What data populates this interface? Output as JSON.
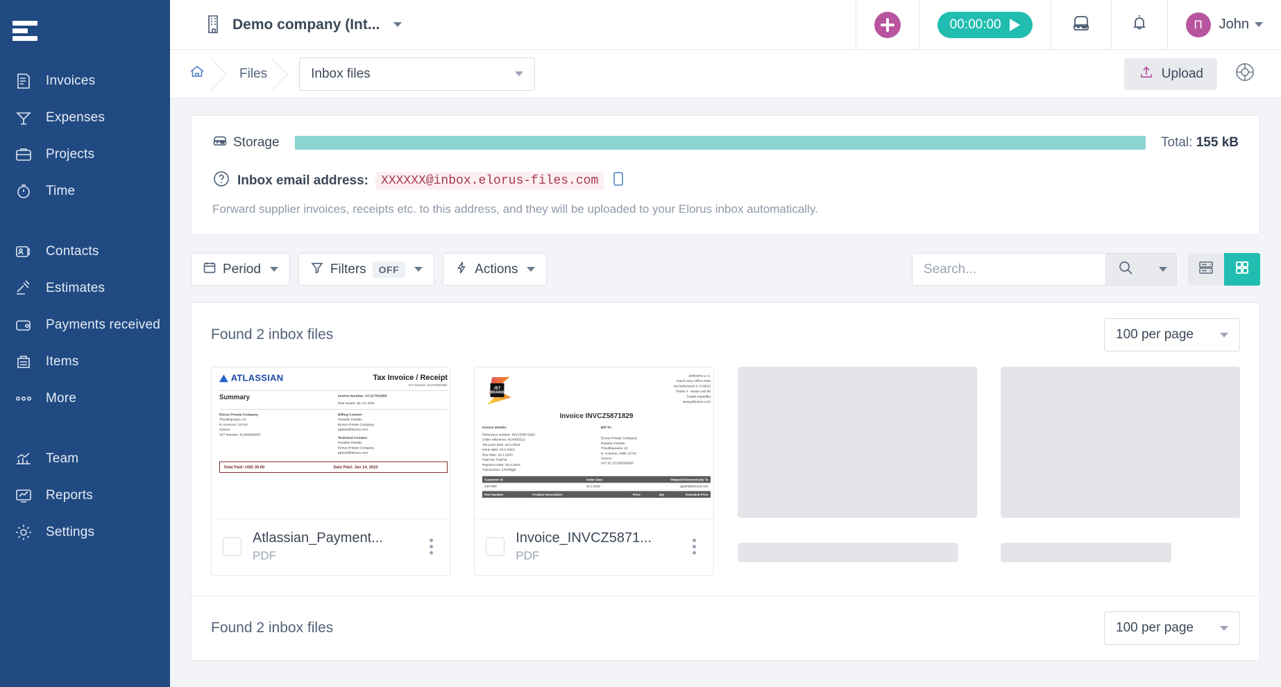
{
  "sidebar": {
    "menu_icon": "hamburger-icon",
    "groups": [
      {
        "items": [
          {
            "label": "Invoices",
            "icon": "invoices-icon"
          },
          {
            "label": "Expenses",
            "icon": "expenses-icon"
          },
          {
            "label": "Projects",
            "icon": "projects-icon"
          },
          {
            "label": "Time",
            "icon": "time-icon"
          }
        ]
      },
      {
        "items": [
          {
            "label": "Contacts",
            "icon": "contacts-icon"
          },
          {
            "label": "Estimates",
            "icon": "estimates-icon"
          },
          {
            "label": "Payments received",
            "icon": "wallet-icon"
          },
          {
            "label": "Items",
            "icon": "items-icon"
          },
          {
            "label": "More",
            "icon": "more-dots-icon"
          }
        ]
      },
      {
        "items": [
          {
            "label": "Team",
            "icon": "team-icon"
          },
          {
            "label": "Reports",
            "icon": "reports-icon"
          },
          {
            "label": "Settings",
            "icon": "gear-icon"
          }
        ]
      }
    ]
  },
  "topbar": {
    "company": "Demo company (Int...",
    "company_icon": "building-icon",
    "add_button": "add-icon",
    "timer": "00:00:00",
    "timer_play": "play-icon",
    "printer_icon": "printer-icon",
    "bell_icon": "bell-icon",
    "avatar_initial": "Π",
    "user_name": "John"
  },
  "breadcrumb": {
    "home_icon": "home-icon",
    "files": "Files",
    "selected_view": "Inbox files",
    "upload_label": "Upload",
    "upload_icon": "upload-icon",
    "help_widget_icon": "support-widget-icon"
  },
  "storage": {
    "label": "Storage",
    "icon": "storage-icon",
    "bar_fill_percent": 96,
    "bar_color": "#8bd4d0",
    "total_prefix": "Total:",
    "total_value": "155 kB",
    "email_label": "Inbox email address:",
    "email_value": "XXXXXX@inbox.elorus-files.com",
    "help_icon": "question-mark-icon",
    "copy_icon": "copy-icon",
    "hint": "Forward supplier invoices, receipts etc. to this address, and they will be uploaded to your Elorus inbox automatically."
  },
  "toolbar": {
    "period_label": "Period",
    "period_icon": "calendar-icon",
    "filters_label": "Filters",
    "filters_state": "OFF",
    "filters_icon": "funnel-icon",
    "actions_label": "Actions",
    "actions_icon": "bolt-icon",
    "search_placeholder": "Search...",
    "search_value": "",
    "search_icon": "search-icon",
    "list_view_icon": "list-view-icon",
    "grid_view_icon": "grid-view-icon",
    "active_view": "grid",
    "accent_color": "#21bdb0"
  },
  "results": {
    "found_label": "Found 2 inbox files",
    "per_page": "100 per page",
    "cards": [
      {
        "filename": "Atlassian_Payment...",
        "filetype": "PDF",
        "checked": false,
        "menu_icon": "kebab-menu-icon"
      },
      {
        "filename": "Invoice_INVCZ5871...",
        "filetype": "PDF",
        "checked": false,
        "menu_icon": "kebab-menu-icon"
      }
    ],
    "placeholders": 2,
    "footer_found_label": "Found 2 inbox files",
    "footer_per_page": "100 per page"
  },
  "doc_atlassian": {
    "brand": "ATLASSIAN",
    "title": "Tax Invoice / Receipt",
    "vat": "VAT Number: EU372001951",
    "summary": "Summary",
    "invoice_number": "Invoice Number: AT-217931855",
    "date_issued": "Date Issued: Jan 14, 2023",
    "company": "Elorus Private Company",
    "addr1": "Theofilopoulou 13",
    "addr2": "N. Kosmos I 11743",
    "addr3": "Greece",
    "vat_number": "VAT Number: EL800585687",
    "billing_title": "Billing Contact:",
    "billing_name": "Pantelis Petridis",
    "billing_company": "Elorus Private Company",
    "billing_email": "ppetrid@elorus.com",
    "tech_title": "Technical Contact:",
    "tech_name": "Pantelis Petridis",
    "tech_company": "Elorus Private Company",
    "tech_email": "ppetrid@elorus.com",
    "total_paid": "Total Paid: USD 30.00",
    "date_paid": "Date Paid: Jan 14, 2023"
  },
  "doc_jetbrains": {
    "vendor1": "JetBrains s.r.o.",
    "vendor2": "Kavčí Hory Office Park",
    "vendor3": "Na hrebenech II 1718/10",
    "vendor4": "Praha 4 - Nusle 140 00",
    "vendor5": "Česká republika",
    "vendor6": "www.jetbrains.com",
    "title": "Invoice INVCZ5871829",
    "details_title": "Invoice Details:",
    "d1": "Reference number: INVCZ5871829",
    "d2": "Order reference: R14000212",
    "d3": "Tax point date: 20.2.2023",
    "d4": "Issue date: 20.2.2023",
    "d5": "Due date: 20.2.2023",
    "d6": "Paid via: PayPal",
    "d7": "Payment Date: 20.2.2023",
    "d8": "Transaction: 17knfkgj3",
    "bill_title": "Bill To:",
    "b1": "Elorus Private Company",
    "b2": "Pantelis Petridis",
    "b3": "Theofilopoulou 13",
    "b4": "N. Kosmos, Attiki 11743",
    "b5": "Greece",
    "b6": "VAT ID: EL800585687",
    "th1": "Customer Id",
    "th2": "Order Date",
    "th3": "Shipped Electronically To",
    "tr1": "2427959",
    "tr2": "20.2.2023",
    "tr3": "ppetrid@elorus.com",
    "th4": "Part Number",
    "th5": "Product Description",
    "th6": "Price",
    "th7": "Qty",
    "th8": "Extended Price"
  }
}
